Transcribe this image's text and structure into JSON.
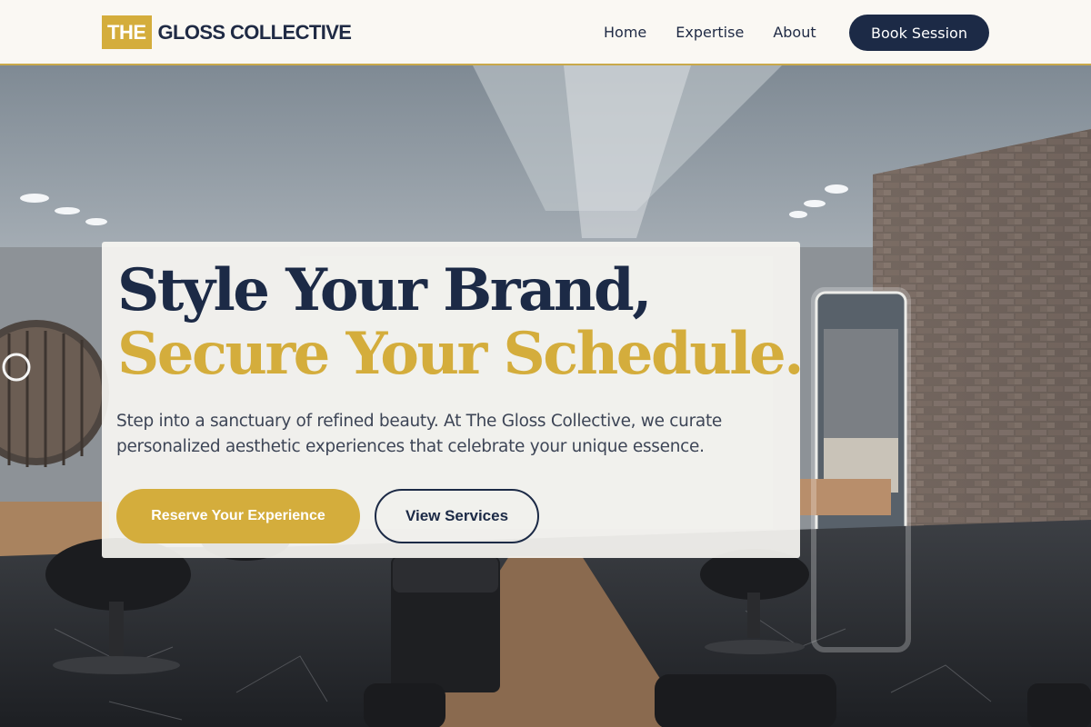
{
  "brand": {
    "badge": "THE",
    "name": "GLOSS COLLECTIVE"
  },
  "nav": {
    "links": [
      "Home",
      "Expertise",
      "About"
    ],
    "cta": "Book Session"
  },
  "hero": {
    "headline_line1": "Style Your Brand,",
    "headline_line2": "Secure Your Schedule.",
    "description": "Step into a sanctuary of refined beauty. At The Gloss Collective, we curate personalized aesthetic experiences that celebrate your unique essence.",
    "primary_cta": "Reserve Your Experience",
    "secondary_cta": "View Services"
  },
  "colors": {
    "navy": "#1c2a46",
    "gold": "#d4ad3c",
    "nav_bg": "#faf8f3"
  }
}
